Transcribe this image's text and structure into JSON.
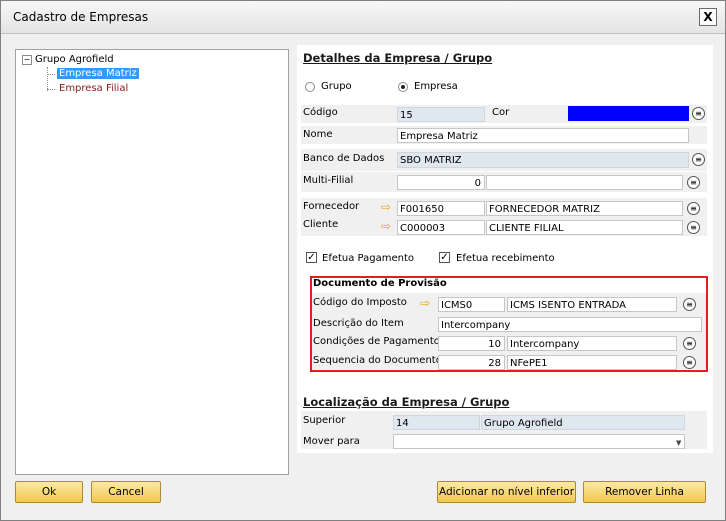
{
  "window": {
    "title": "Cadastro de Empresas",
    "close_glyph": "X"
  },
  "tree": {
    "expander": "−",
    "root": "Grupo Agrofield",
    "children": [
      "Empresa Matriz",
      "Empresa Filial"
    ]
  },
  "details": {
    "title": "Detalhes da Empresa / Grupo",
    "radio_group": "Grupo",
    "radio_company": "Empresa",
    "selected_type": "Empresa",
    "codigo_label": "Código",
    "codigo_value": "15",
    "cor_label": "Cor",
    "cor_value": "#0000ff",
    "nome_label": "Nome",
    "nome_value": "Empresa Matriz",
    "banco_label": "Banco de Dados",
    "banco_value": "SBO MATRIZ",
    "multi_label": "Multi-Filial",
    "multi_value": "0",
    "fornecedor_label": "Fornecedor",
    "fornecedor_code": "F001650",
    "fornecedor_name": "FORNECEDOR MATRIZ",
    "cliente_label": "Cliente",
    "cliente_code": "C000003",
    "cliente_name": "CLIENTE FILIAL",
    "efetua_pagamento": "Efetua Pagamento",
    "efetua_recebimento": "Efetua recebimento",
    "check_glyph": "✓"
  },
  "provisao": {
    "title": "Documento de Provisão",
    "codigo_imposto_label": "Código do Imposto",
    "codigo_imposto_value": "ICMS0",
    "codigo_imposto_desc": "ICMS ISENTO ENTRADA",
    "descricao_label": "Descrição do Item",
    "descricao_value": "Intercompany",
    "condicoes_label": "Condições de Pagamento",
    "condicoes_value": "10",
    "condicoes_desc": "Intercompany",
    "sequencia_label": "Sequencia do Documento",
    "sequencia_value": "28",
    "sequencia_desc": "NFePE1"
  },
  "localizacao": {
    "title": "Localização da Empresa / Grupo",
    "superior_label": "Superior",
    "superior_code": "14",
    "superior_name": "Grupo Agrofield",
    "mover_label": "Mover para",
    "mover_value": ""
  },
  "icons": {
    "lookup": "≡",
    "link_arrow": "⇨",
    "dropdown": "▼"
  },
  "buttons": {
    "ok": "Ok",
    "cancel": "Cancel",
    "add_lower": "Adicionar no nível inferior",
    "remove_line": "Remover Linha"
  }
}
